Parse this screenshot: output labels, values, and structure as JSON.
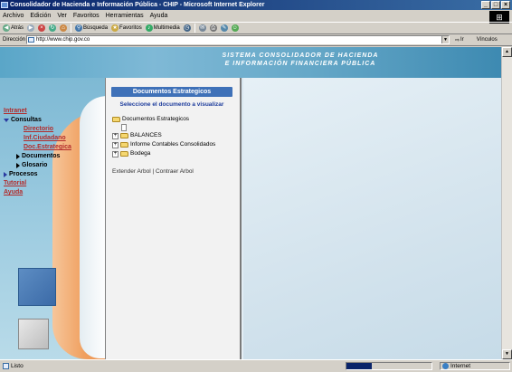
{
  "window": {
    "title": "Consolidador de Hacienda e Información Pública - CHIP - Microsoft Internet Explorer",
    "buttons": [
      "_",
      "□",
      "×"
    ]
  },
  "menu": [
    "Archivo",
    "Edición",
    "Ver",
    "Favoritos",
    "Herramientas",
    "Ayuda"
  ],
  "toolbar": {
    "back": "Atrás",
    "search": "Búsqueda",
    "favorites": "Favoritos",
    "multimedia": "Multimedia"
  },
  "address": {
    "label": "Dirección",
    "url": "http://www.chip.gov.co",
    "go": "Ir",
    "links": "Vínculos"
  },
  "banner": {
    "line1": "SISTEMA CONSOLIDADOR DE HACIENDA",
    "line2": "E INFORMACIÓN FINANCIERA PÚBLICA"
  },
  "nav": {
    "intranet": "Intranet",
    "consultas": "Consultas",
    "directorio": "Directorio",
    "infcuidadano": "Inf.Ciudadano",
    "docestrategica": "Doc.Estrategica",
    "documentos": "Documentos",
    "glosario": "Glosario",
    "procesos": "Procesos",
    "tutorial": "Tutorial",
    "ayuda": "Ayuda"
  },
  "docs": {
    "header": "Documentos Estrategicos",
    "prompt": "Seleccione el documento a visualizar",
    "root": "Documentos Estrategicos",
    "items": [
      "BALANCES",
      "Informe Contables Consolidados",
      "Bodega"
    ],
    "expand": "Extender Arbol",
    "sep": "|",
    "collapse": "Contraer Arbol"
  },
  "status": {
    "text": "Listo",
    "zone": "Internet",
    "progress": 0.3
  }
}
